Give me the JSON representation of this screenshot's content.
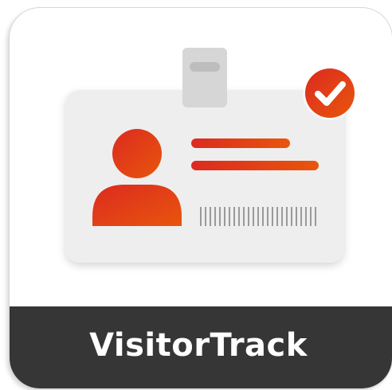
{
  "app": {
    "name": "VisitorTrack",
    "icon": "visitor-badge-icon",
    "badge_icon": "checkmark-icon"
  },
  "colors": {
    "accent_start": "#e0291c",
    "accent_end": "#e84a0c",
    "band": "#363636",
    "card": "#eeeeee",
    "barcode": "#9a9a9a"
  }
}
